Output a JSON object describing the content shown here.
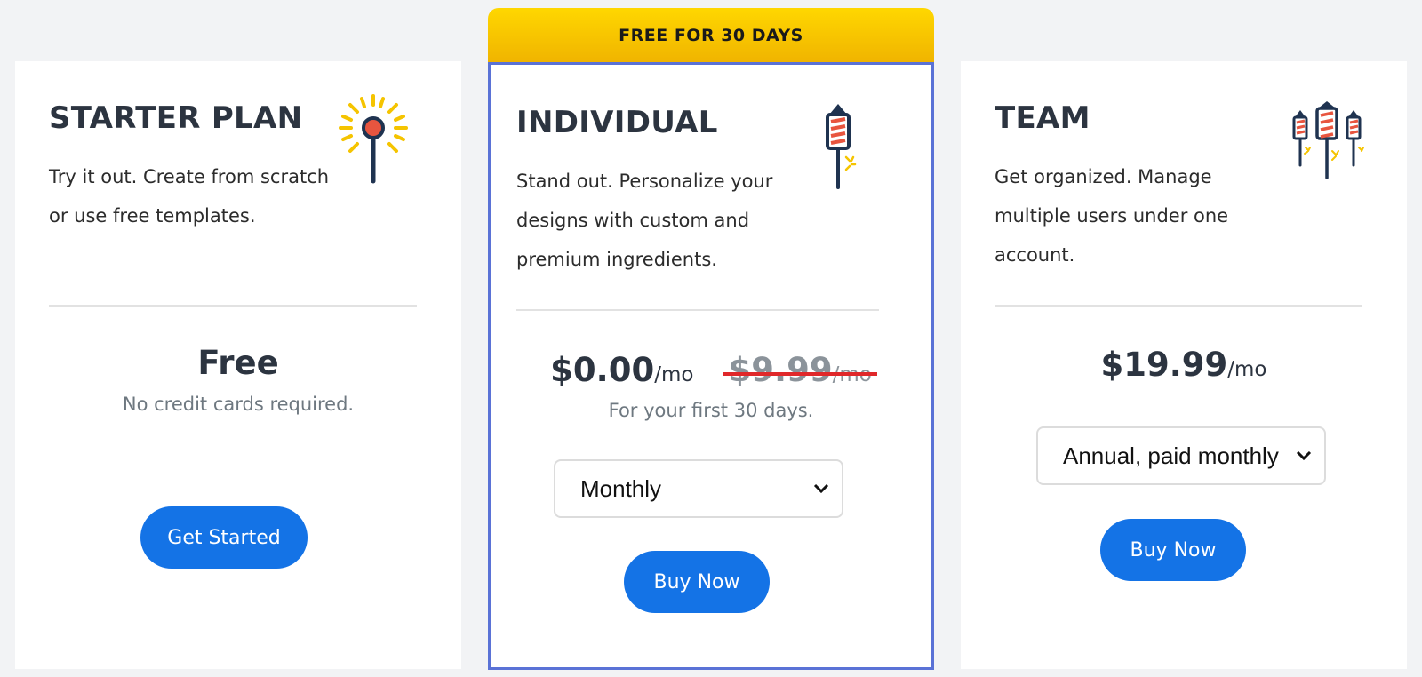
{
  "ribbon": {
    "label": "FREE FOR 30 DAYS"
  },
  "plans": [
    {
      "title": "STARTER PLAN",
      "description": "Try it out. Create from scratch or use free templates.",
      "price": "Free",
      "note": "No credit cards required.",
      "button": "Get Started",
      "icon": "sparkler-icon"
    },
    {
      "title": "INDIVIDUAL",
      "description": "Stand out. Personalize your designs with custom and premium ingredients.",
      "price": "$0.00",
      "per": "/mo",
      "old_price": "$9.99",
      "old_per": "/mo",
      "note": "For your first 30 days.",
      "billing_selected": "Monthly",
      "button": "Buy Now",
      "icon": "firework-rocket-icon"
    },
    {
      "title": "TEAM",
      "description": "Get organized. Manage multiple users under one account.",
      "price": "$19.99",
      "per": "/mo",
      "billing_selected": "Annual, paid monthly",
      "button": "Buy Now",
      "icon": "firework-rockets-icon"
    }
  ],
  "colors": {
    "accent_button": "#1473e6",
    "ribbon_yellow": "#ffd700",
    "highlight_border": "#5a72d6",
    "strike_red": "#e0282a",
    "icon_navy": "#1f3350",
    "icon_red": "#e8553f",
    "icon_yellow": "#f5c400"
  }
}
